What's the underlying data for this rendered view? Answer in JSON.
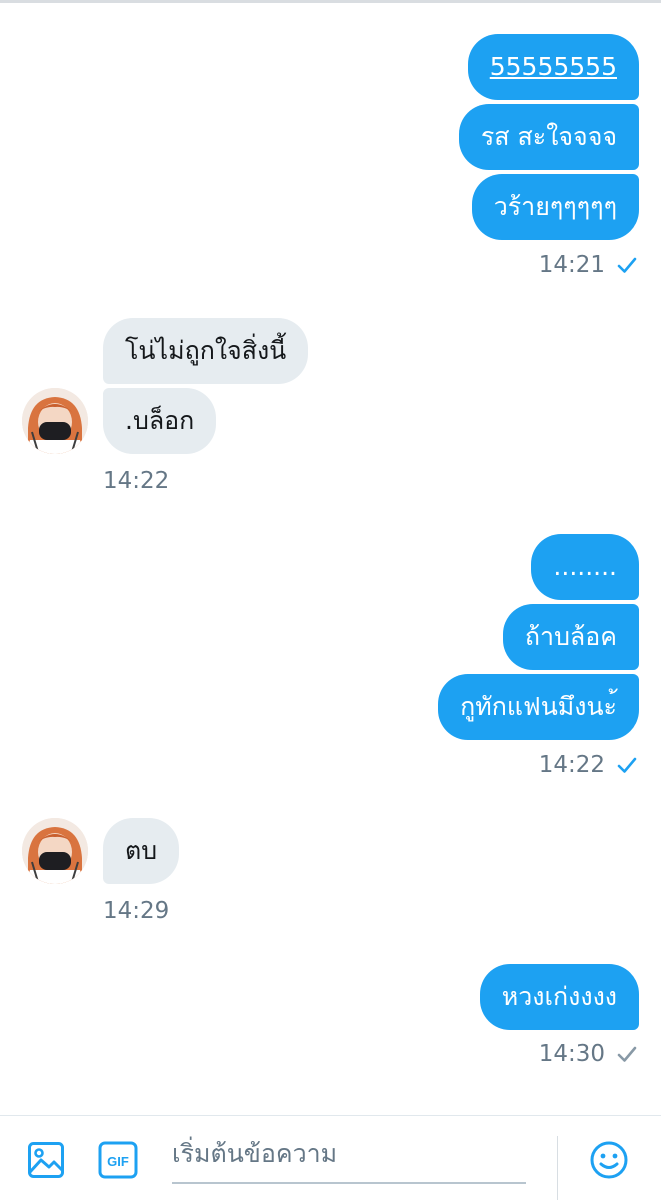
{
  "thread": {
    "groups": [
      {
        "direction": "out",
        "messages": [
          "55555555",
          "รส สะใจจจจ",
          "วร้ายๆๆๆๆๆ"
        ],
        "time": "14:21",
        "status": "read"
      },
      {
        "direction": "in",
        "messages": [
          "โน่ไม่ถูกใจสิ่งนี้",
          ".บล็อก"
        ],
        "time": "14:22"
      },
      {
        "direction": "out",
        "messages": "........",
        "messages_list": [
          "........",
          "ถ้าบล้อค",
          "กูทักแฟนมึงนะ้"
        ],
        "time": "14:22",
        "status": "read"
      },
      {
        "direction": "in",
        "messages_list": [
          "ตบ"
        ],
        "time": "14:29"
      },
      {
        "direction": "out",
        "messages_list": [
          "หวงเก่งงงง"
        ],
        "time": "14:30",
        "status": "sent"
      }
    ]
  },
  "composer": {
    "placeholder": "เริ่มต้นข้อความ",
    "gif_label": "GIF",
    "image_icon": "image-icon",
    "emoji_icon": "emoji-icon"
  },
  "colors": {
    "outgoing_bubble": "#1da1f2",
    "incoming_bubble": "#e6ecf0",
    "meta_text": "#657786",
    "check_read": "#1da1f2",
    "check_sent": "#8899a6"
  }
}
